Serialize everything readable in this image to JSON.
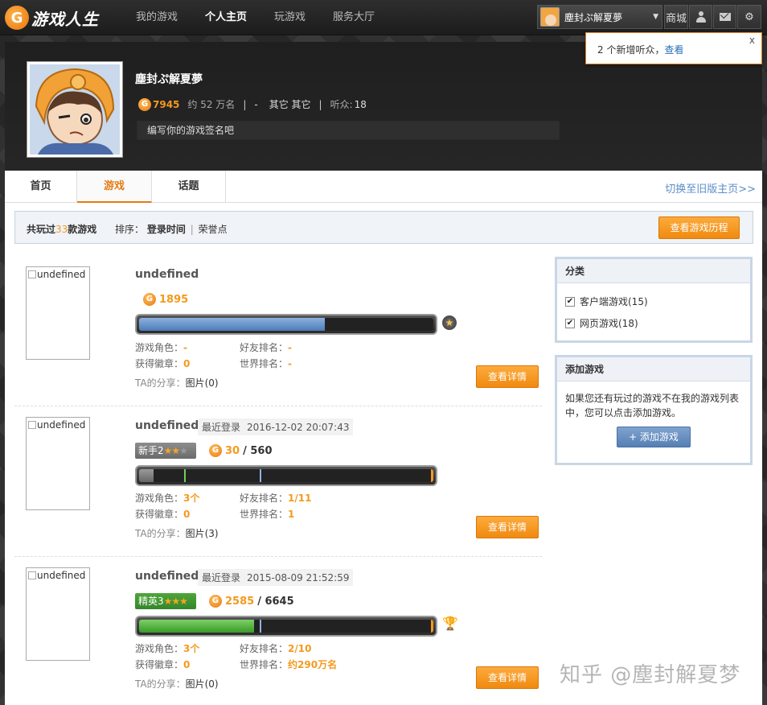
{
  "topbar": {
    "logo_text": "游戏人生",
    "nav": [
      "我的游戏",
      "个人主页",
      "玩游戏",
      "服务大厅"
    ],
    "user_name": "塵封ぷ解夏夢",
    "shop_label": "商城"
  },
  "notification": {
    "text": "2 个新增听众，",
    "link": "查看",
    "close": "x"
  },
  "profile": {
    "name": "塵封ぷ解夏夢",
    "score": "7945",
    "rank": "约 52 万名",
    "sep": "|",
    "dash": "-",
    "region": "其它 其它",
    "listeners_label": "听众:",
    "listeners": "18",
    "signature_placeholder": "编写你的游戏签名吧"
  },
  "tabs": [
    "首页",
    "游戏",
    "话题"
  ],
  "old_version_link": "切换至旧版主页>>",
  "sortbar": {
    "prefix": "共玩过",
    "count": "33",
    "suffix": "款游戏",
    "sort_label": "排序：",
    "sort_current": "登录时间",
    "divider": "|",
    "sort_other": "荣誉点",
    "history_button": "查看游戏历程"
  },
  "game_labels": {
    "role": "游戏角色：",
    "friend_rank": "好友排名：",
    "badges": "获得徽章：",
    "world_rank": "世界排名：",
    "share": "TA的分享：",
    "detail_button": "查看详情",
    "last_login": "最近登录",
    "thumb_alt": "undefined",
    "coin_icon_glyph": "G"
  },
  "games": [
    {
      "name": "undefined",
      "last_login": "",
      "level": "",
      "stars": "",
      "score": "1895",
      "score_total": "",
      "progress": 0.63,
      "badge": "star-badge-icon",
      "badge_glyph": "★",
      "role": "-",
      "friend_rank": "-",
      "badges": "0",
      "world_rank": "-",
      "share": "图片(0)"
    },
    {
      "name": "undefined",
      "last_login": "2016-12-02 20:07:43",
      "level": "新手2",
      "stars_on": "★★",
      "stars_off": "★",
      "score": "30",
      "score_total": "/ 560",
      "progress": 0.05,
      "badge": "",
      "role": "3个",
      "friend_rank": "1/11",
      "badges": "0",
      "world_rank": "1",
      "share": "图片(3)"
    },
    {
      "name": "undefined",
      "last_login": "2015-08-09 21:52:59",
      "level": "精英3",
      "stars_on": "★★★",
      "stars_off": "",
      "score": "2585",
      "score_total": "/ 6645",
      "progress": 0.39,
      "badge": "trophy-icon",
      "badge_glyph": "🏆",
      "role": "3个",
      "friend_rank": "2/10",
      "badges": "0",
      "world_rank": "约290万名",
      "share": "图片(0)"
    }
  ],
  "sidebar": {
    "category_title": "分类",
    "categories": [
      "客户端游戏(15)",
      "网页游戏(18)"
    ],
    "check_glyph": "✔",
    "add_title": "添加游戏",
    "add_text": "如果您还有玩过的游戏不在我的游戏列表中，您可以点击添加游戏。",
    "add_button": "+ 添加游戏"
  },
  "watermark": "知乎 @塵封解夏梦"
}
